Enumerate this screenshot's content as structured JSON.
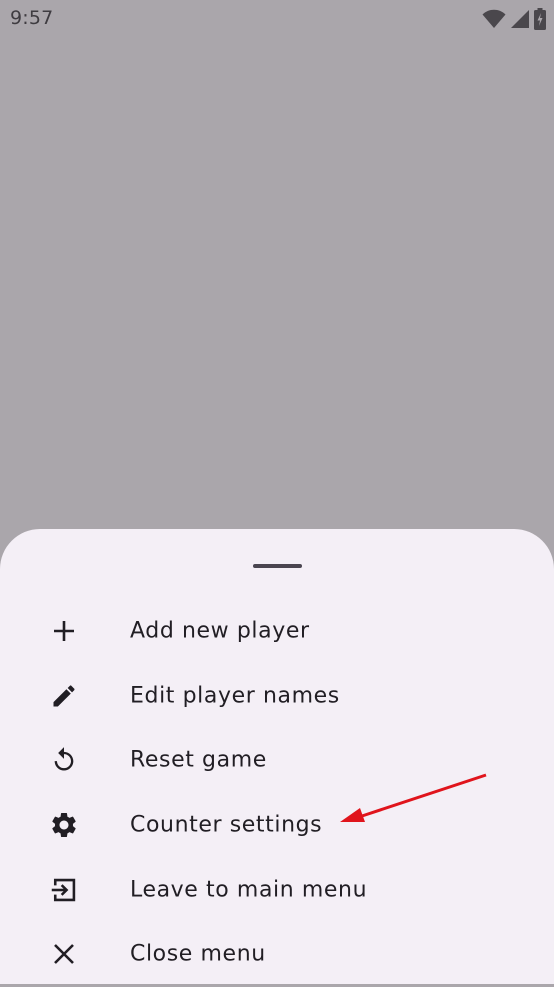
{
  "status_bar": {
    "time": "9:57",
    "icons": [
      "wifi-icon",
      "cell-signal-icon",
      "battery-charging-icon"
    ]
  },
  "bottom_sheet": {
    "items": [
      {
        "label": "Add new player",
        "icon": "plus-icon"
      },
      {
        "label": "Edit player names",
        "icon": "pencil-icon"
      },
      {
        "label": "Reset game",
        "icon": "reset-icon"
      },
      {
        "label": "Counter settings",
        "icon": "gear-icon"
      },
      {
        "label": "Leave to main menu",
        "icon": "exit-icon"
      },
      {
        "label": "Close menu",
        "icon": "close-icon"
      }
    ]
  },
  "colors": {
    "scrim": "#aaa6ab",
    "sheet_background": "#f4eff6",
    "text": "#211e24",
    "handle": "#4a4550",
    "annotation_arrow": "#e0141c"
  }
}
